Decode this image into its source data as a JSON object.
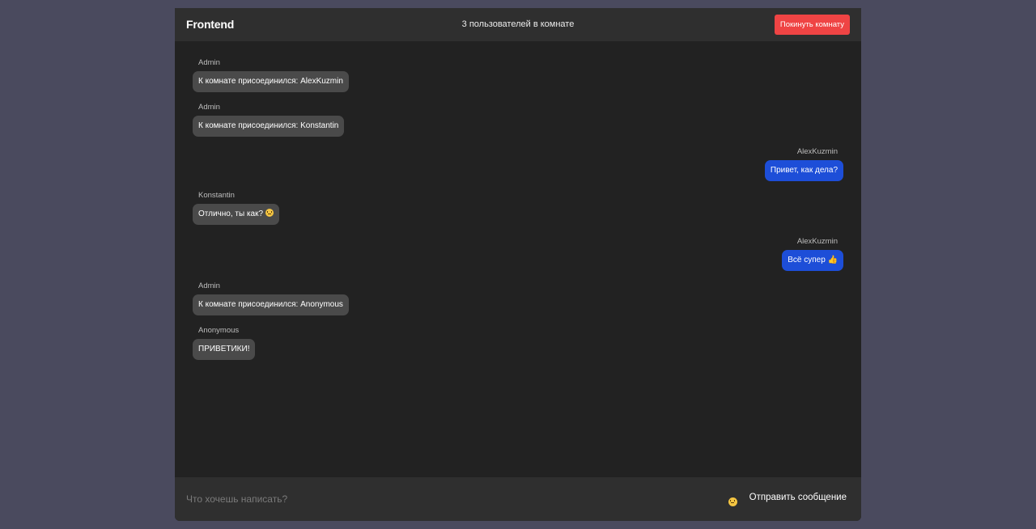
{
  "header": {
    "room_title": "Frontend",
    "users_count": "3 пользователей в комнате",
    "leave_label": "Покинуть комнату"
  },
  "colors": {
    "accent_red": "#ef4444",
    "own_bubble": "#1d4ed8",
    "other_bubble": "#4a4a4a"
  },
  "messages": [
    {
      "author": "Admin",
      "text": "К комнате присоединился: AlexKuzmin",
      "side": "left"
    },
    {
      "author": "Admin",
      "text": "К комнате присоединился: Konstantin",
      "side": "left"
    },
    {
      "author": "AlexKuzmin",
      "text": "Привет, как дела?",
      "side": "right"
    },
    {
      "author": "Konstantin",
      "text": "Отлично, ты как?",
      "emoji": "smiling-face-icon",
      "side": "left"
    },
    {
      "author": "AlexKuzmin",
      "text": "Всё супер",
      "emoji": "thumbs-up-icon",
      "side": "right"
    },
    {
      "author": "Admin",
      "text": "К комнате присоединился: Anonymous",
      "side": "left"
    },
    {
      "author": "Anonymous",
      "text": "ПРИВЕТИКИ!",
      "side": "left"
    }
  ],
  "footer": {
    "input_placeholder": "Что хочешь написать?",
    "input_value": "",
    "emoji_icon": "smiling-face-icon",
    "send_label": "Отправить сообщение"
  }
}
